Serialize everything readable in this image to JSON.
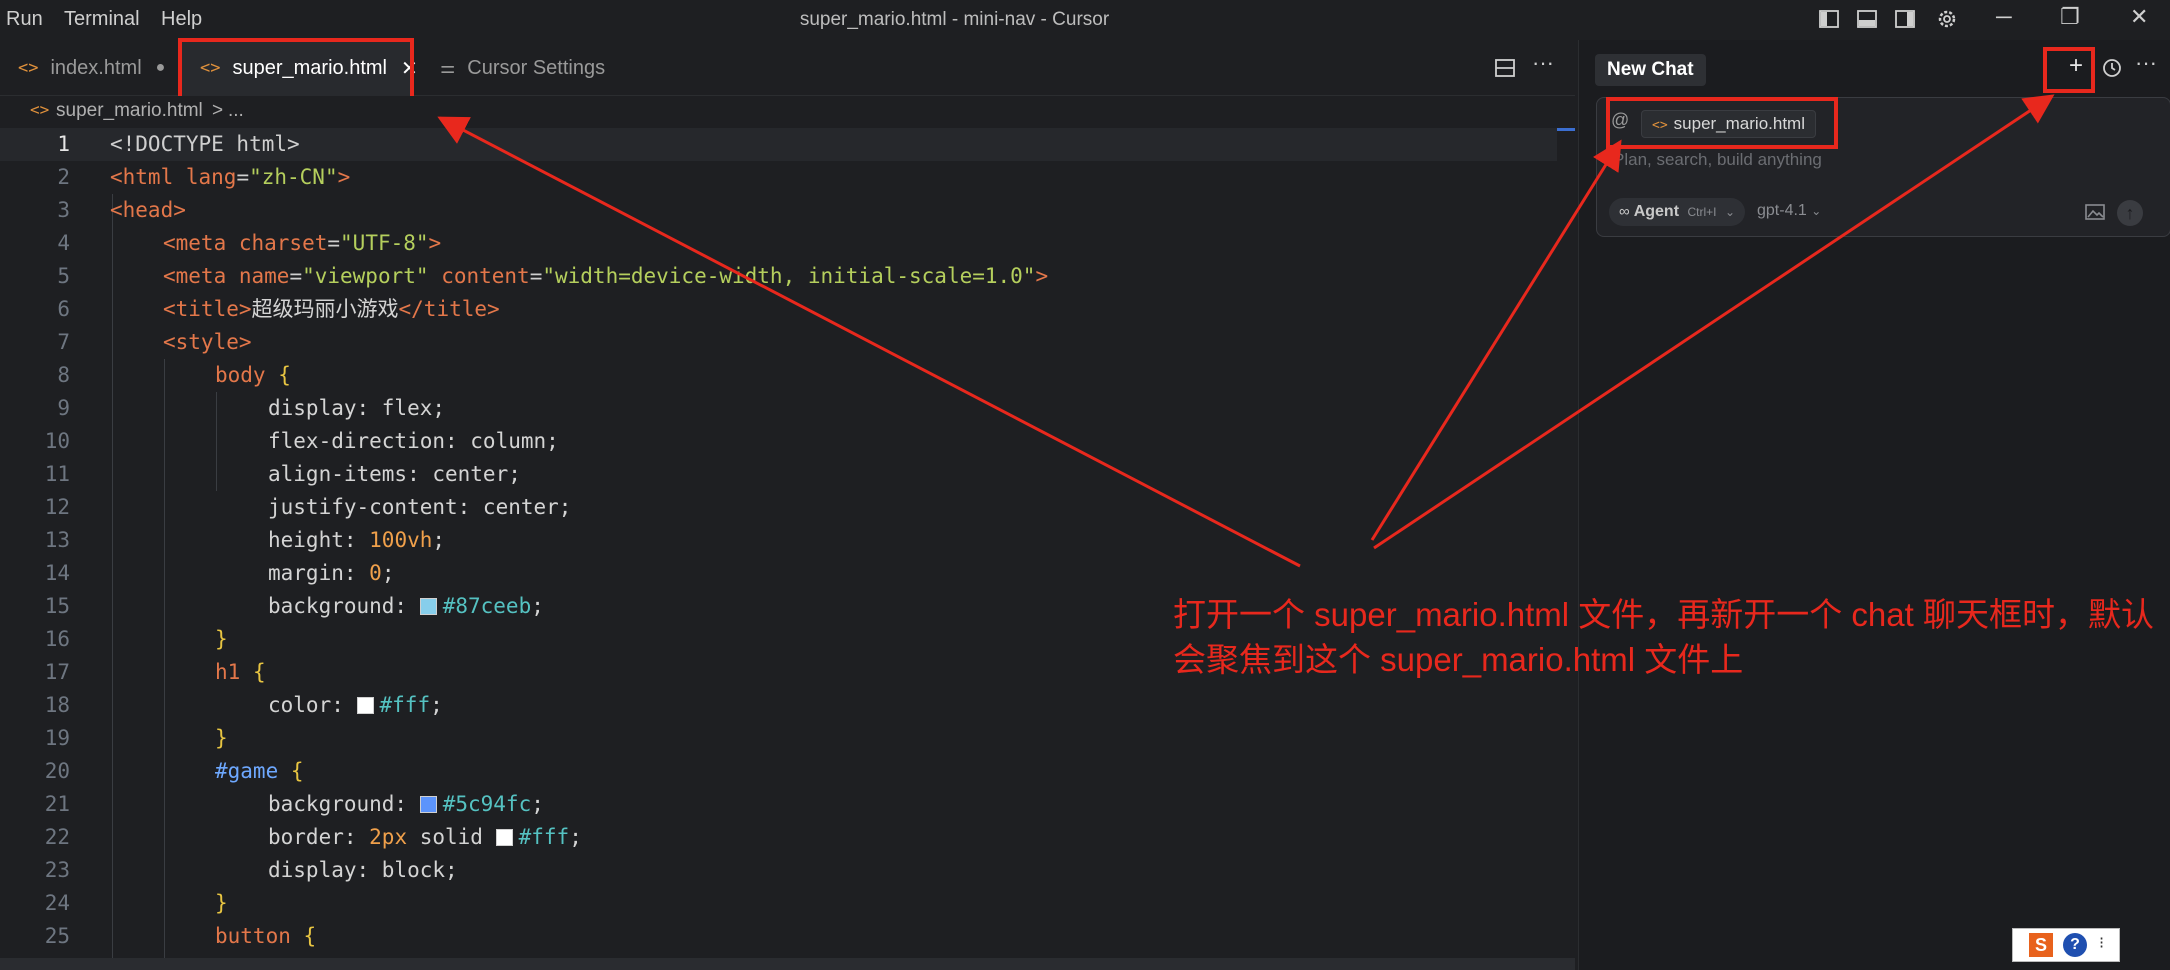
{
  "window": {
    "title": "super_mario.html - mini-nav - Cursor",
    "menu": [
      "Run",
      "Terminal",
      "Help"
    ]
  },
  "tabs": [
    {
      "label": "index.html",
      "modified": true
    },
    {
      "label": "super_mario.html",
      "active": true
    },
    {
      "label": "Cursor Settings"
    }
  ],
  "breadcrumb": {
    "file": "super_mario.html",
    "sep": ">",
    "more": "..."
  },
  "code_lines": [
    {
      "n": "1"
    },
    {
      "n": "2"
    },
    {
      "n": "3"
    },
    {
      "n": "4"
    },
    {
      "n": "5"
    },
    {
      "n": "6"
    },
    {
      "n": "7"
    },
    {
      "n": "8"
    },
    {
      "n": "9"
    },
    {
      "n": "10"
    },
    {
      "n": "11"
    },
    {
      "n": "12"
    },
    {
      "n": "13"
    },
    {
      "n": "14"
    },
    {
      "n": "15"
    },
    {
      "n": "16"
    },
    {
      "n": "17"
    },
    {
      "n": "18"
    },
    {
      "n": "19"
    },
    {
      "n": "20"
    },
    {
      "n": "21"
    },
    {
      "n": "22"
    },
    {
      "n": "23"
    },
    {
      "n": "24"
    },
    {
      "n": "25"
    }
  ],
  "code": {
    "l1_doctype": "<!DOCTYPE html>",
    "l2_open": "<html ",
    "l2_attr": "lang",
    "l2_val": "\"zh-CN\"",
    "l2_close": ">",
    "l3": "<head>",
    "l4_open": "<meta ",
    "l4_attr": "charset",
    "l4_val": "\"UTF-8\"",
    "l4_close": ">",
    "l5_open": "<meta ",
    "l5_attr1": "name",
    "l5_val1": "\"viewport\"",
    "l5_attr2": "content",
    "l5_val2": "\"width=device-width, initial-scale=1.0\"",
    "l5_close": ">",
    "l6_open": "<title>",
    "l6_text": "超级玛丽小游戏",
    "l6_close": "</title>",
    "l7": "<style>",
    "l8_sel": "body",
    "l8_brace": " {",
    "l9": "display: flex;",
    "l10": "flex-direction: column;",
    "l11": "align-items: center;",
    "l12": "justify-content: center;",
    "l13_prop": "height: ",
    "l13_val": "100vh",
    "l13_end": ";",
    "l14_prop": "margin: ",
    "l14_val": "0",
    "l14_end": ";",
    "l15_prop": "background: ",
    "l15_val": "#87ceeb",
    "l15_end": ";",
    "l16": "}",
    "l17_sel": "h1",
    "l17_brace": " {",
    "l18_prop": "color: ",
    "l18_val": "#fff",
    "l18_end": ";",
    "l19": "}",
    "l20_sel": "#game",
    "l20_brace": " {",
    "l21_prop": "background: ",
    "l21_val": "#5c94fc",
    "l21_end": ";",
    "l22_prop": "border: ",
    "l22_num": "2px",
    "l22_mid": " solid ",
    "l22_val": "#fff",
    "l22_end": ";",
    "l23": "display: block;",
    "l24": "}",
    "l25_sel": "button",
    "l25_brace": " {"
  },
  "colors": {
    "accent": "#e8281d",
    "swatch_sky": "#87ceeb",
    "swatch_white": "#ffffff",
    "swatch_blue": "#5c94fc"
  },
  "chat": {
    "new_chat": "New Chat",
    "at_symbol": "@",
    "context_file": "super_mario.html",
    "placeholder": "Plan, search, build anything",
    "agent_label": "Agent",
    "agent_shortcut": "Ctrl+I",
    "model": "gpt-4.1"
  },
  "annotation": {
    "line1": "打开一个 super_mario.html 文件，再新开一个 chat 聊天框时，默认",
    "line2": "会聚焦到这个 super_mario.html 文件上"
  }
}
